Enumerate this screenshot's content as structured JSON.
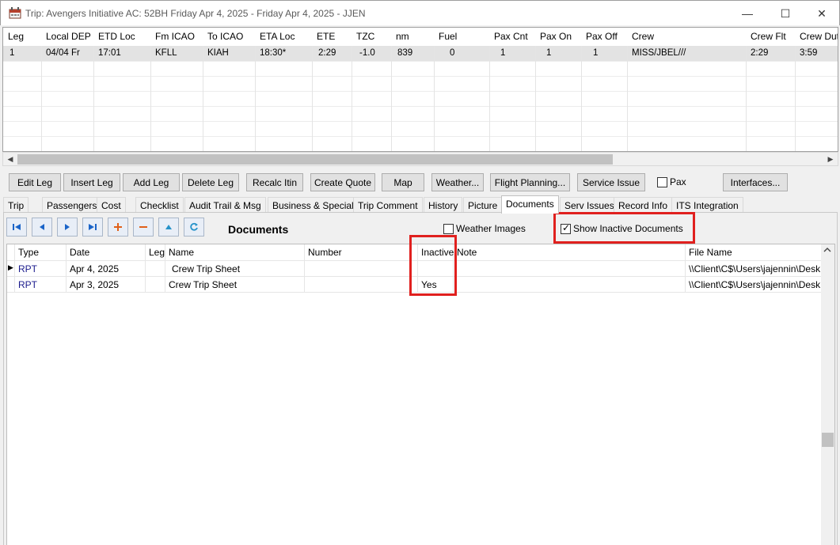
{
  "window": {
    "title": "Trip: Avengers Initiative  AC: 52BH  Friday Apr 4, 2025 - Friday Apr 4, 2025 - JJEN",
    "minimize": "—",
    "maximize": "☐",
    "close": "✕"
  },
  "legs": {
    "columns": [
      "Leg",
      "Local DEP",
      "ETD Loc",
      "Fm ICAO",
      "To ICAO",
      "ETA Loc",
      "ETE",
      "TZC",
      "nm",
      "Fuel",
      "Pax Cnt",
      "Pax On",
      "Pax Off",
      "Crew",
      "Crew Flt",
      "Crew Dut"
    ],
    "rows": [
      [
        "1",
        "04/04 Fr",
        "17:01",
        "KFLL",
        "KIAH",
        "18:30*",
        "2:29",
        "-1.0",
        "839",
        "0",
        "1",
        "1",
        "1",
        "MISS/JBEL///",
        "2:29",
        "3:59"
      ]
    ]
  },
  "scrollbar": {
    "left_arrow": "◀",
    "right_arrow": "▶"
  },
  "toolbar": {
    "edit_leg": "Edit Leg",
    "insert_leg": "Insert Leg",
    "add_leg": "Add Leg",
    "delete_leg": "Delete Leg",
    "recalc_itin": "Recalc Itin",
    "create_quote": "Create Quote",
    "map": "Map",
    "weather": "Weather...",
    "flight_planning": "Flight Planning...",
    "service_issue": "Service Issue",
    "pax_label": "Pax",
    "interfaces": "Interfaces..."
  },
  "tabs": [
    "Trip",
    "Passengers",
    "Cost",
    "Checklist",
    "Audit Trail & Msg",
    "Business & Special",
    "Trip Comment",
    "History",
    "Picture",
    "Documents",
    "Serv Issues",
    "Record Info",
    "ITS Integration"
  ],
  "active_tab": "Documents",
  "documents": {
    "title": "Documents",
    "weather_images_label": "Weather Images",
    "weather_images_checked": false,
    "show_inactive_label": "Show Inactive Documents",
    "show_inactive_checked": true,
    "nav_icons": [
      "first-icon",
      "prev-icon",
      "next-icon",
      "last-icon",
      "add-icon",
      "remove-icon",
      "up-icon",
      "refresh-icon"
    ],
    "columns": [
      "Type",
      "Date",
      "Leg",
      "Name",
      "Number",
      "Inactive",
      "Note",
      "File Name"
    ],
    "rows": [
      {
        "type": "RPT",
        "date": "Apr 4, 2025",
        "leg": "",
        "name": "Crew Trip Sheet",
        "number": "",
        "inactive": "",
        "note": "",
        "file": "\\\\Client\\C$\\Users\\jajennin\\Desk"
      },
      {
        "type": "RPT",
        "date": "Apr 3, 2025",
        "leg": "",
        "name": "Crew Trip Sheet",
        "number": "",
        "inactive": "Yes",
        "note": "",
        "file": "\\\\Client\\C$\\Users\\jajennin\\Desk"
      }
    ],
    "row_indicator": "▶"
  },
  "colors": {
    "highlight": "#e0201e",
    "type_text": "#1a1a8c",
    "selected_row": "#e3e3e3"
  }
}
